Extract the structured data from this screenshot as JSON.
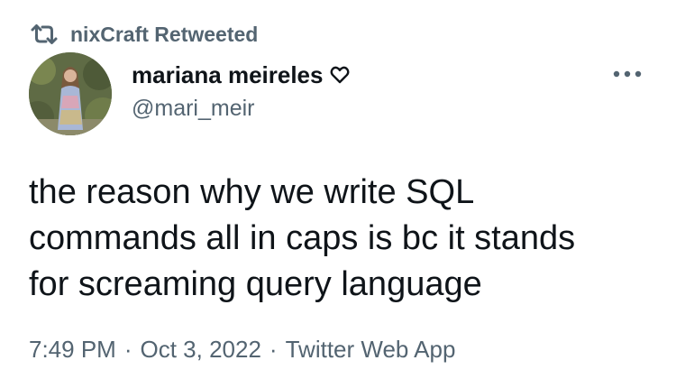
{
  "retweet_context": {
    "icon": "retweet-icon",
    "label": "nixCraft Retweeted"
  },
  "author": {
    "avatar": "avatar-photo",
    "display_name": "mariana meireles",
    "name_emoji_icon": "heart-outline-icon",
    "handle": "@mari_meir"
  },
  "more_menu": {
    "icon": "more-options-icon"
  },
  "tweet": {
    "lines": [
      "the reason why we write SQL",
      "commands all in caps is bc it stands",
      "for screaming query language"
    ]
  },
  "meta": {
    "time": "7:49 PM",
    "separator": "·",
    "date": "Oct 3, 2022",
    "source": "Twitter Web App"
  },
  "colors": {
    "text": "#0f1419",
    "secondary": "#536471",
    "background": "#ffffff"
  }
}
